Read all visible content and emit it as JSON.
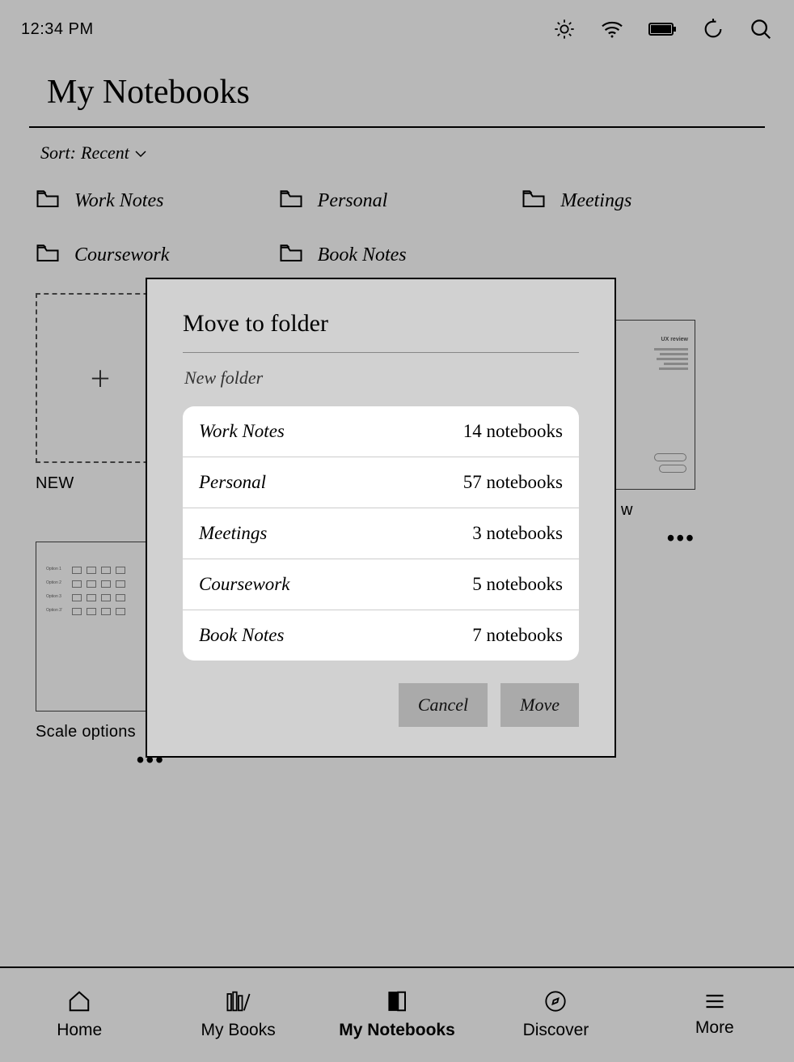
{
  "status": {
    "time": "12:34 PM"
  },
  "page": {
    "title": "My Notebooks",
    "sort_prefix": "Sort: ",
    "sort_value": "Recent"
  },
  "folders_row": [
    {
      "label": "Work Notes"
    },
    {
      "label": "Personal"
    },
    {
      "label": "Meetings"
    },
    {
      "label": "Coursework"
    },
    {
      "label": "Book Notes"
    }
  ],
  "notebooks": {
    "new_label": "NEW",
    "items": [
      {
        "label": "w",
        "has_more": true
      },
      {
        "label": "Scale options",
        "has_more": true
      }
    ]
  },
  "modal": {
    "title": "Move to folder",
    "new_folder_label": "New folder",
    "folders": [
      {
        "name": "Work Notes",
        "count": "14 notebooks"
      },
      {
        "name": "Personal",
        "count": "57 notebooks"
      },
      {
        "name": "Meetings",
        "count": "3 notebooks"
      },
      {
        "name": "Coursework",
        "count": "5 notebooks"
      },
      {
        "name": "Book Notes",
        "count": "7 notebooks"
      }
    ],
    "cancel_label": "Cancel",
    "move_label": "Move"
  },
  "nav": {
    "home": "Home",
    "mybooks": "My Books",
    "mynotebooks": "My Notebooks",
    "discover": "Discover",
    "more": "More"
  }
}
